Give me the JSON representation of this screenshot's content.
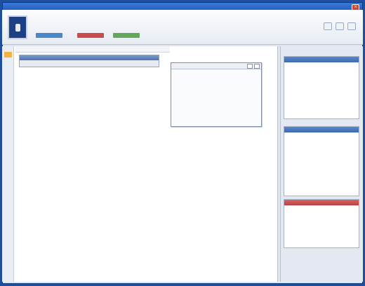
{
  "window": {
    "title": ""
  },
  "header": {
    "title": "",
    "nav": ""
  },
  "breadcrumb": "",
  "toolbar": {
    "title": "",
    "items": [
      "",
      "",
      ""
    ]
  },
  "document": {
    "lines": [
      {
        "t": "",
        "c": ""
      },
      {
        "t": "",
        "c": "h"
      },
      {
        "t": "",
        "c": "ind"
      },
      {
        "t": "",
        "c": "ind"
      },
      {
        "t": "",
        "c": "ind"
      },
      {
        "t": "",
        "c": "h"
      },
      {
        "t": "",
        "c": "ind"
      },
      {
        "t": "",
        "c": "ind"
      },
      {
        "t": "",
        "c": "h"
      },
      {
        "t": "",
        "c": ""
      },
      {
        "t": "",
        "c": ""
      },
      {
        "t": "",
        "c": "h"
      },
      {
        "t": "",
        "c": ""
      },
      {
        "t": "",
        "c": "ind"
      },
      {
        "t": "",
        "c": "ind"
      },
      {
        "t": "",
        "c": "h"
      },
      {
        "t": "",
        "c": ""
      },
      {
        "t": "",
        "c": "ind"
      },
      {
        "t": "",
        "c": "ind"
      },
      {
        "t": "",
        "c": "h"
      },
      {
        "t": "",
        "c": ""
      },
      {
        "t": "",
        "c": ""
      },
      {
        "t": "",
        "c": "h"
      },
      {
        "t": "",
        "c": ""
      },
      {
        "t": "",
        "c": ""
      }
    ]
  },
  "popup": {
    "title": "",
    "lines": [
      "",
      "",
      "",
      "",
      "",
      "",
      "",
      "",
      ""
    ]
  },
  "sidebar": {
    "box1": {
      "title": "",
      "items": [
        "",
        "",
        "",
        "",
        "",
        "",
        "",
        "",
        "",
        ""
      ]
    },
    "box2": {
      "title": "",
      "items": [
        "",
        "",
        "",
        "",
        "",
        "",
        "",
        "",
        "",
        "",
        "",
        ""
      ]
    },
    "box3": {
      "title": "",
      "items": [
        "",
        "",
        "",
        "",
        ""
      ]
    }
  },
  "colors": {
    "accent": "#1f4f9c",
    "header_red": "#c84c4c",
    "header_green": "#62a85a",
    "highlight": "#f4b243"
  },
  "icons": [
    "close-icon",
    "logo-icon",
    "toolbar-icon"
  ]
}
